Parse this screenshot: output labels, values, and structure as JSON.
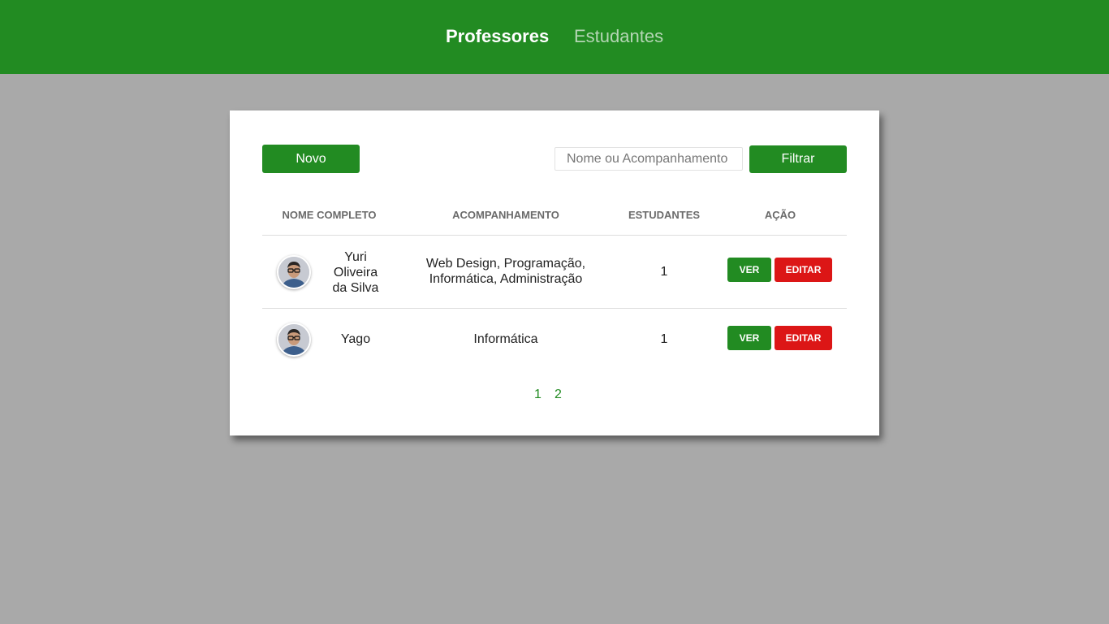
{
  "nav": {
    "items": [
      {
        "label": "Professores",
        "active": true
      },
      {
        "label": "Estudantes",
        "active": false
      }
    ]
  },
  "toolbar": {
    "new_label": "Novo",
    "search_placeholder": "Nome ou Acompanhamento",
    "search_value": "",
    "filter_label": "Filtrar"
  },
  "table": {
    "headers": [
      "NOME COMPLETO",
      "ACOMPANHAMENTO",
      "ESTUDANTES",
      "AÇÃO"
    ],
    "rows": [
      {
        "name": "Yuri Oliveira da Silva",
        "tracking": "Web Design, Programação, Informática, Administração",
        "students": "1",
        "view_label": "VER",
        "edit_label": "EDITAR"
      },
      {
        "name": "Yago",
        "tracking": "Informática",
        "students": "1",
        "view_label": "VER",
        "edit_label": "EDITAR"
      }
    ]
  },
  "pagination": {
    "pages": [
      "1",
      "2"
    ]
  },
  "colors": {
    "primary": "#228b22",
    "danger": "#dc1616",
    "background": "#a9a9a9"
  }
}
